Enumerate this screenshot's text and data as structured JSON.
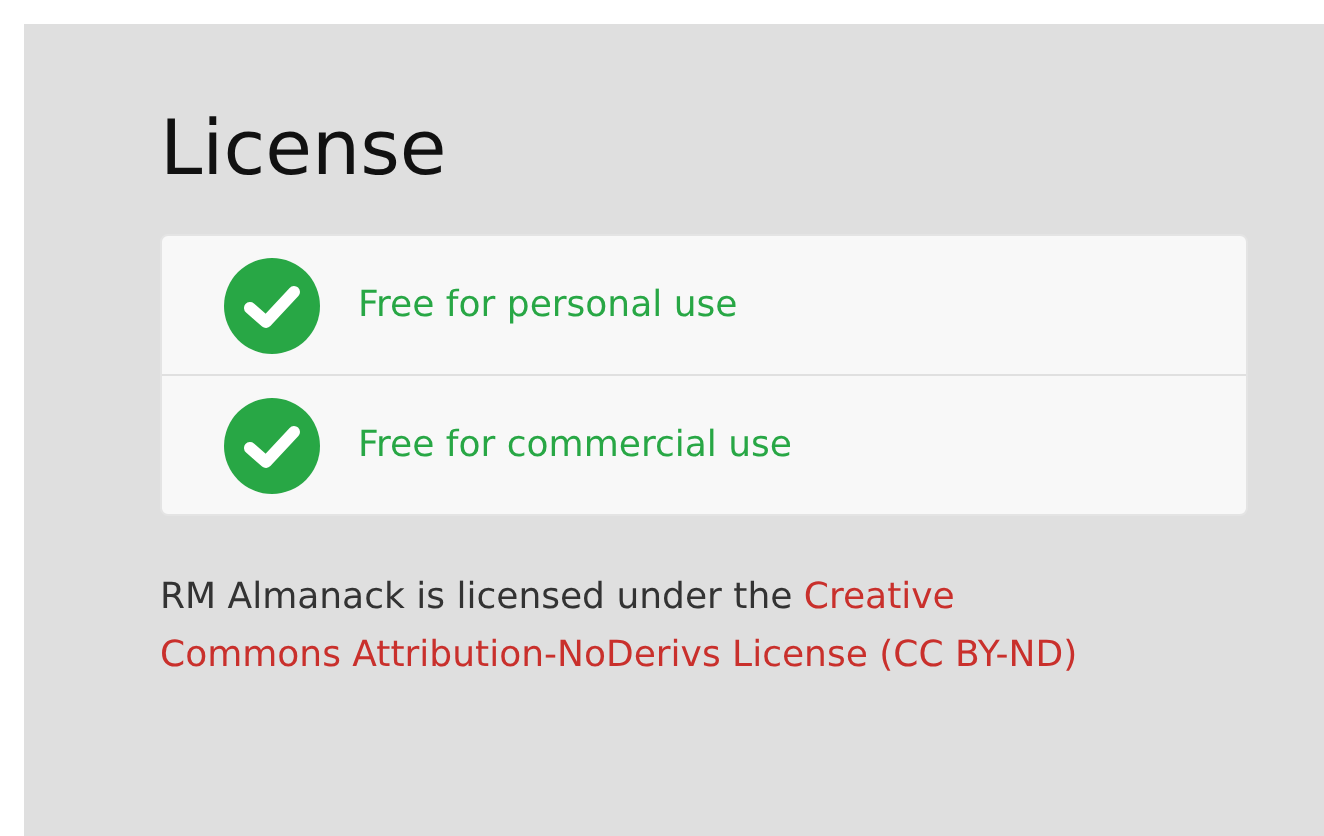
{
  "heading": "License",
  "features": [
    {
      "label": "Free for personal use",
      "checked": true
    },
    {
      "label": "Free for commercial use",
      "checked": true
    }
  ],
  "note": {
    "text": "RM Almanack is licensed under the ",
    "link": "Creative Commons Attribution-NoDerivs License (CC BY-ND)"
  }
}
